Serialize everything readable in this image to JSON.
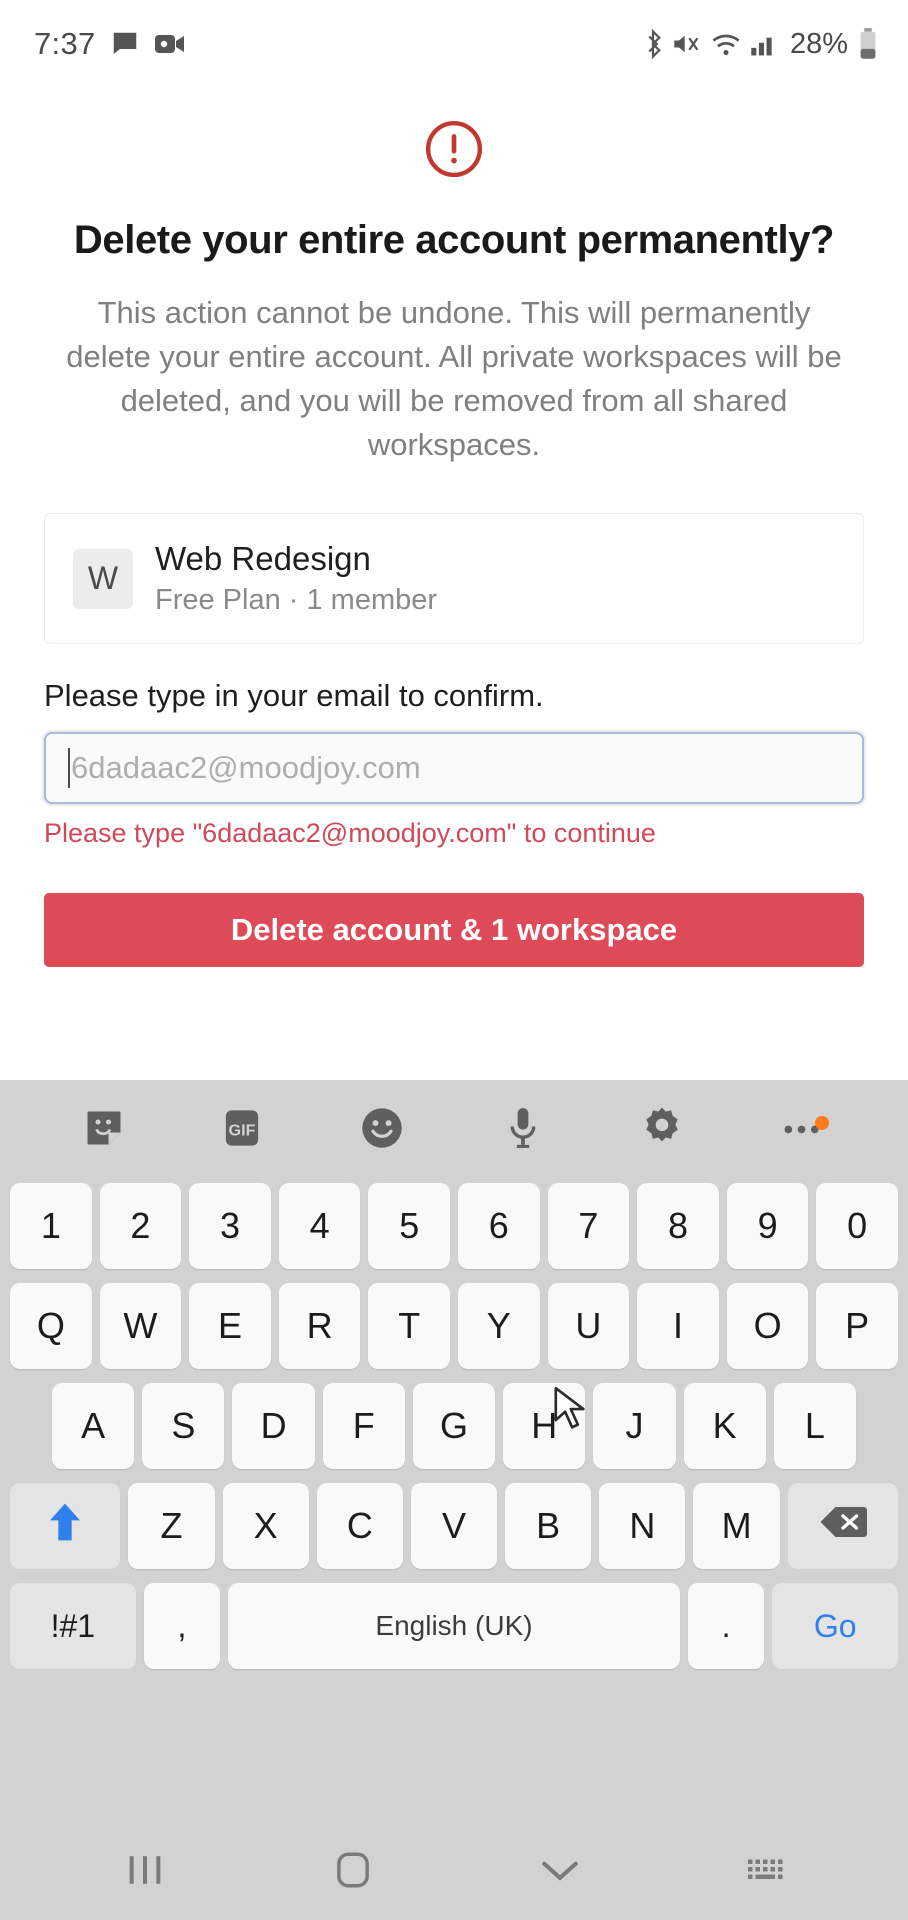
{
  "status_bar": {
    "time": "7:37",
    "battery_percent": "28%",
    "icons": [
      "message-icon",
      "video-camera-icon",
      "bluetooth-icon",
      "sound-mute-icon",
      "wifi-icon",
      "cellular-signal-icon",
      "battery-icon"
    ]
  },
  "dialog": {
    "alert_icon": "alert-circle-icon",
    "accent_color": "#c0392f",
    "title": "Delete your entire account permanently?",
    "description": "This action cannot be undone. This will permanently delete your entire account. All private workspaces will be deleted, and you will be removed from all shared workspaces.",
    "workspace": {
      "avatar_letter": "W",
      "name": "Web Redesign",
      "subtitle": "Free Plan · 1 member"
    },
    "form": {
      "label": "Please type in your email to confirm.",
      "input_value": "",
      "input_placeholder": "6dadaac2@moodjoy.com",
      "error": "Please type \"6dadaac2@moodjoy.com\" to continue"
    },
    "delete_button": {
      "label": "Delete account & 1 workspace",
      "color": "#dd4a58"
    }
  },
  "keyboard": {
    "toolbar": [
      "sticker-icon",
      "gif-icon",
      "emoji-icon",
      "microphone-icon",
      "settings-gear-icon",
      "more-options-icon"
    ],
    "row_numbers": [
      "1",
      "2",
      "3",
      "4",
      "5",
      "6",
      "7",
      "8",
      "9",
      "0"
    ],
    "row_top": [
      "Q",
      "W",
      "E",
      "R",
      "T",
      "Y",
      "U",
      "I",
      "O",
      "P"
    ],
    "row_home": [
      "A",
      "S",
      "D",
      "F",
      "G",
      "H",
      "J",
      "K",
      "L"
    ],
    "row_bottom": [
      "Z",
      "X",
      "C",
      "V",
      "B",
      "N",
      "M"
    ],
    "shift_label": "shift-icon",
    "backspace_label": "backspace-icon",
    "symbols_key": "!#1",
    "comma_key": ",",
    "space_key": "English (UK)",
    "period_key": ".",
    "enter_key": "Go",
    "shift_active_color": "#2f80ed"
  },
  "nav_bar": {
    "recents": "recents-icon",
    "home": "home-icon",
    "hide_keyboard": "hide-keyboard-icon",
    "switch_keyboard": "keyboard-switch-icon"
  }
}
